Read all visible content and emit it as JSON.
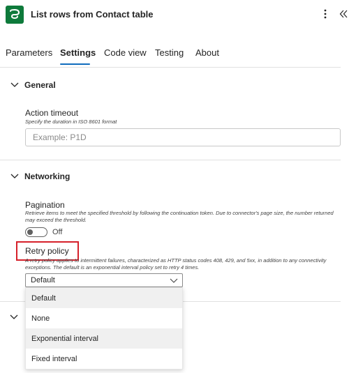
{
  "header": {
    "title": "List rows from Contact table",
    "app_icon": "dataverse-icon",
    "more_icon": "more-vertical-icon",
    "collapse_icon": "double-chevron-left-icon",
    "brand_color": "#0e7a3b"
  },
  "tabs": [
    {
      "label": "Parameters",
      "active": false
    },
    {
      "label": "Settings",
      "active": true
    },
    {
      "label": "Code view",
      "active": false
    },
    {
      "label": "Testing",
      "active": false
    },
    {
      "label": "About",
      "active": false
    }
  ],
  "general": {
    "heading": "General",
    "timeout": {
      "label": "Action timeout",
      "description": "Specify the duration in ISO 8601 format",
      "value": "",
      "placeholder": "Example: P1D"
    }
  },
  "networking": {
    "heading": "Networking",
    "pagination": {
      "label": "Pagination",
      "description": "Retrieve items to meet the specified threshold by following the continuation token. Due to connector's page size, the number returned may exceed the threshold.",
      "toggle_state": "Off"
    },
    "retry": {
      "label": "Retry policy",
      "description": "A retry policy applies to intermittent failures, characterized as HTTP status codes 408, 429, and 5xx, in addition to any connectivity exceptions. The default is an exponential interval policy set to retry 4 times.",
      "selected": "Default",
      "options": [
        "Default",
        "None",
        "Exponential interval",
        "Fixed interval"
      ]
    }
  },
  "colors": {
    "accent": "#0f6cbd",
    "highlight": "#d6202a"
  }
}
